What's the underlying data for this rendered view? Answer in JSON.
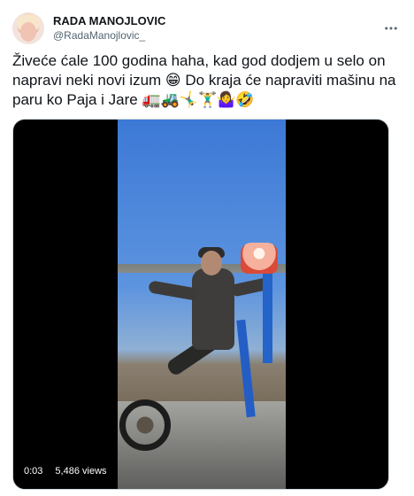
{
  "tweet": {
    "display_name": "RADA MANOJLOVIC",
    "handle": "@RadaManojlovic_",
    "text": "Živeće ćale 100 godina haha, kad god dodjem u selo on napravi neki novi izum 😁 Do kraja će napraviti mašinu na paru ko Paja i Jare 🚛🚜🤸‍♂️🏋️‍♂️🤷‍♀️🤣",
    "more_icon": "ellipsis-icon",
    "media": {
      "duration": "0:03",
      "views": "5,486 views",
      "play_state": "paused",
      "theme_colors": {
        "sky": "#3c79d6",
        "field": "#7e6d59",
        "machine": "#2462c8",
        "tank": "#e3533f"
      }
    }
  }
}
